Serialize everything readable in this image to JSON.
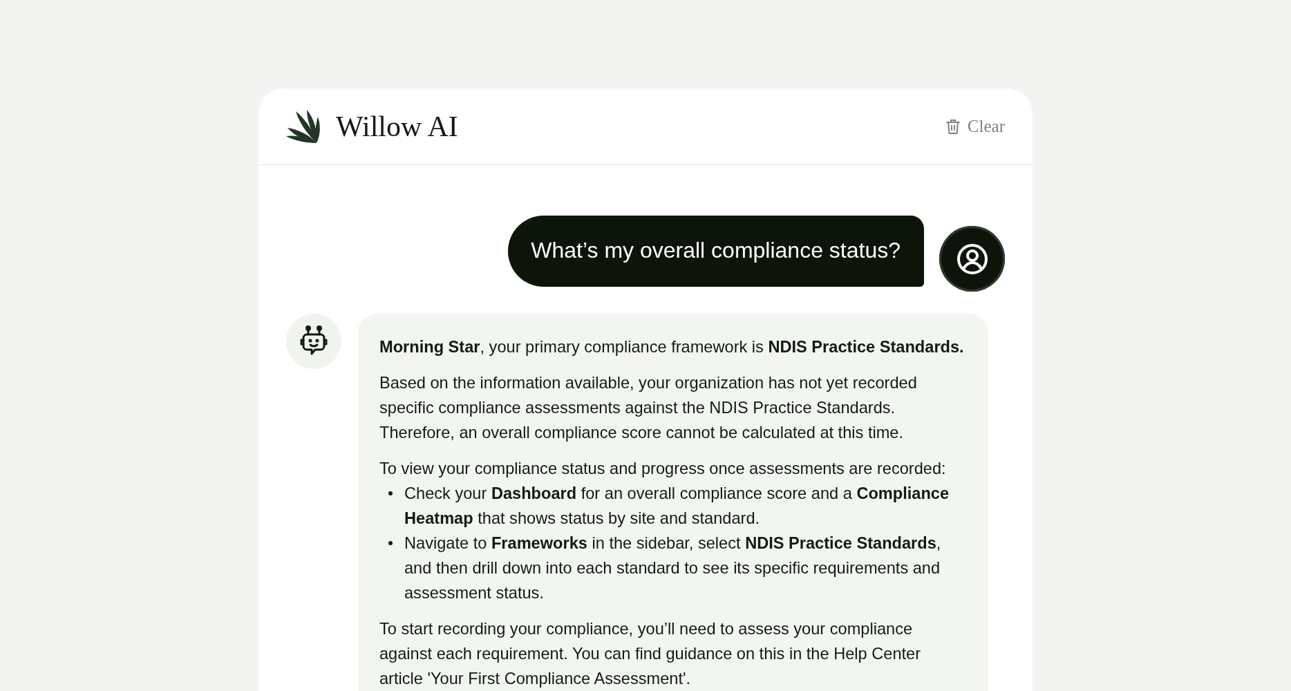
{
  "header": {
    "title": "Willow AI",
    "clear_label": "Clear"
  },
  "messages": [
    {
      "kind": "user",
      "text": "What’s my overall compliance status?"
    },
    {
      "kind": "assistant",
      "blocks": [
        {
          "kind": "paragraph",
          "text": "**Morning Star**, your primary compliance framework is **NDIS Practice Standards.**"
        },
        {
          "kind": "paragraph",
          "text": "Based on the information available, your organization has not yet recorded specific compliance assessments against the NDIS Practice Standards. Therefore, an overall compliance score cannot be calculated at this time."
        },
        {
          "kind": "list",
          "lead": "To view your compliance status and progress once assessments are recorded:",
          "items": [
            "Check your **Dashboard** for an overall compliance score and a **Compliance Heatmap** that shows status by site and standard.",
            "Navigate to **Frameworks** in the sidebar, select **NDIS Practice Standards**, and then drill down into each standard to see its specific requirements and assessment status."
          ]
        },
        {
          "kind": "paragraph",
          "text": "To start recording your compliance, you’ll need to assess your compliance against each requirement. You can find guidance on this in the Help Center article 'Your First Compliance Assessment'."
        }
      ]
    }
  ]
}
